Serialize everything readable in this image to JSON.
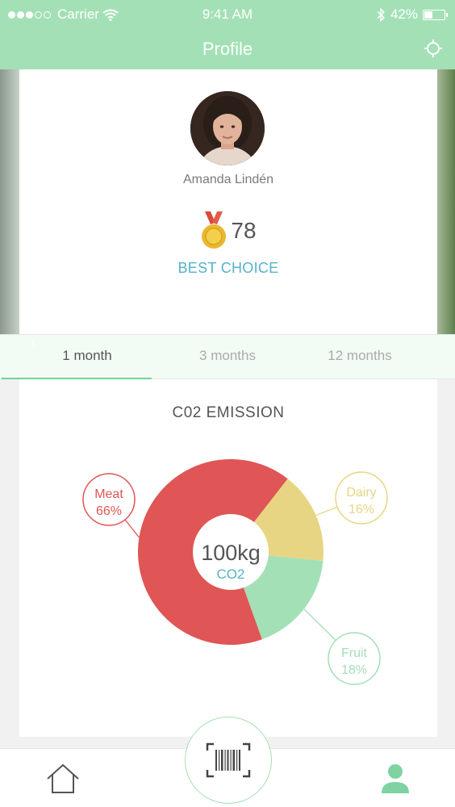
{
  "status_bar": {
    "carrier": "Carrier",
    "time": "9:41 AM",
    "battery": "42%",
    "battery_level": 0.42
  },
  "nav": {
    "title": "Profile",
    "right_icon": "target-icon"
  },
  "profile": {
    "name": "Amanda Lindén",
    "score": "78",
    "rank": "BEST CHOICE",
    "medal_icon": "medal-icon"
  },
  "tabs": [
    {
      "label": "1 month",
      "active": true
    },
    {
      "label": "3 months",
      "active": false
    },
    {
      "label": "12 months",
      "active": false
    }
  ],
  "emission": {
    "title": "C02 EMISSION",
    "total": "100kg",
    "unit": "CO2"
  },
  "chart_data": {
    "type": "pie",
    "title": "C02 EMISSION",
    "center_text": [
      "100kg",
      "CO2"
    ],
    "categories": [
      "Meat",
      "Dairy",
      "Fruit"
    ],
    "values": [
      66,
      16,
      18
    ],
    "labels": [
      "66%",
      "16%",
      "18%"
    ],
    "colors": [
      "#e05555",
      "#e8d583",
      "#a3e0b6"
    ]
  },
  "bottom_bar": {
    "home_icon": "home-icon",
    "scan_icon": "barcode-scan-icon",
    "profile_icon": "user-icon"
  },
  "colors": {
    "accent": "#a3e0b6",
    "link": "#56b2c9",
    "meat": "#e05555",
    "dairy": "#e8d583",
    "fruit": "#a3e0b6"
  }
}
